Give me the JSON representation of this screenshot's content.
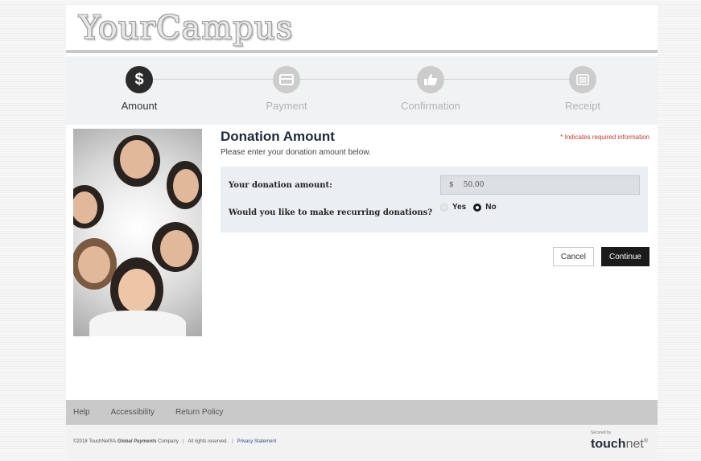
{
  "header": {
    "logo_text": "YourCampus"
  },
  "steps": [
    {
      "label": "Amount",
      "icon": "dollar-icon",
      "glyph": "$",
      "state": "active"
    },
    {
      "label": "Payment",
      "icon": "credit-card-icon",
      "glyph": "",
      "state": "inactive"
    },
    {
      "label": "Confirmation",
      "icon": "thumbs-up-icon",
      "glyph": "",
      "state": "inactive"
    },
    {
      "label": "Receipt",
      "icon": "list-icon",
      "glyph": "",
      "state": "inactive"
    }
  ],
  "form": {
    "title": "Donation Amount",
    "subtitle": "Please enter your donation amount below.",
    "required_note": "* Indicates required information",
    "amount_label": "Your donation amount:",
    "currency_symbol": "$",
    "amount_value": "50.00",
    "recurring_label": "Would you like to make recurring donations?",
    "recurring_options": [
      {
        "label": "Yes",
        "selected": false
      },
      {
        "label": "No",
        "selected": true
      }
    ]
  },
  "buttons": {
    "cancel": "Cancel",
    "continue": "Continue"
  },
  "footer_nav": {
    "help": "Help",
    "accessibility": "Accessibility",
    "return_policy": "Return Policy"
  },
  "footer": {
    "copyright": "©2018 TouchNet®A",
    "company": "Global Payments",
    "company_suffix": "Company",
    "rights": "All rights reserved.",
    "privacy": "Privacy Statement",
    "secured_by": "Secured by",
    "brand_bold": "touch",
    "brand_light": "net",
    "brand_mark": "®"
  },
  "colors": {
    "active_step": "#2b2b2b",
    "inactive_step": "#cccccc",
    "continue_button": "#1b1b1b",
    "required_note": "#c0392b"
  }
}
